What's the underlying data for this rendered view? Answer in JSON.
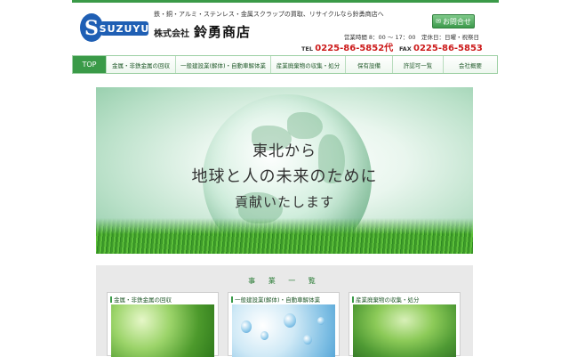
{
  "header": {
    "tagline": "鉄・銅・アルミ・ステンレス・金属スクラップの買取、リサイクルなら鈴勇商店へ",
    "logo_text": "SUZUYU",
    "company_prefix": "株式会社",
    "company_name": "鈴勇商店",
    "contact_button": "お問合せ",
    "hours": "営業時間 8：00 〜 17：00　定休日：日曜・祝祭日",
    "tel_label": "TEL",
    "tel_number": "0225-86-5852代",
    "fax_label": "FAX",
    "fax_number": "0225-86-5853"
  },
  "nav": [
    "TOP",
    "金属・非鉄金属の回収",
    "一般建設業(解体)・自動車解体業",
    "産業廃棄物の収集・処分",
    "保有設備",
    "許認可一覧",
    "会社概要"
  ],
  "hero": {
    "line1": "東北から",
    "line2": "地球と人の未来のために",
    "line3": "貢献いたします"
  },
  "business": {
    "title": "事 業 一 覧",
    "cards": [
      "金属・非鉄金属の回収",
      "一般建設業(解体)・自動車解体業",
      "産業廃棄物の収集・処分"
    ]
  },
  "colors": {
    "accent": "#3a9a48",
    "phone": "#cc1a1a"
  }
}
